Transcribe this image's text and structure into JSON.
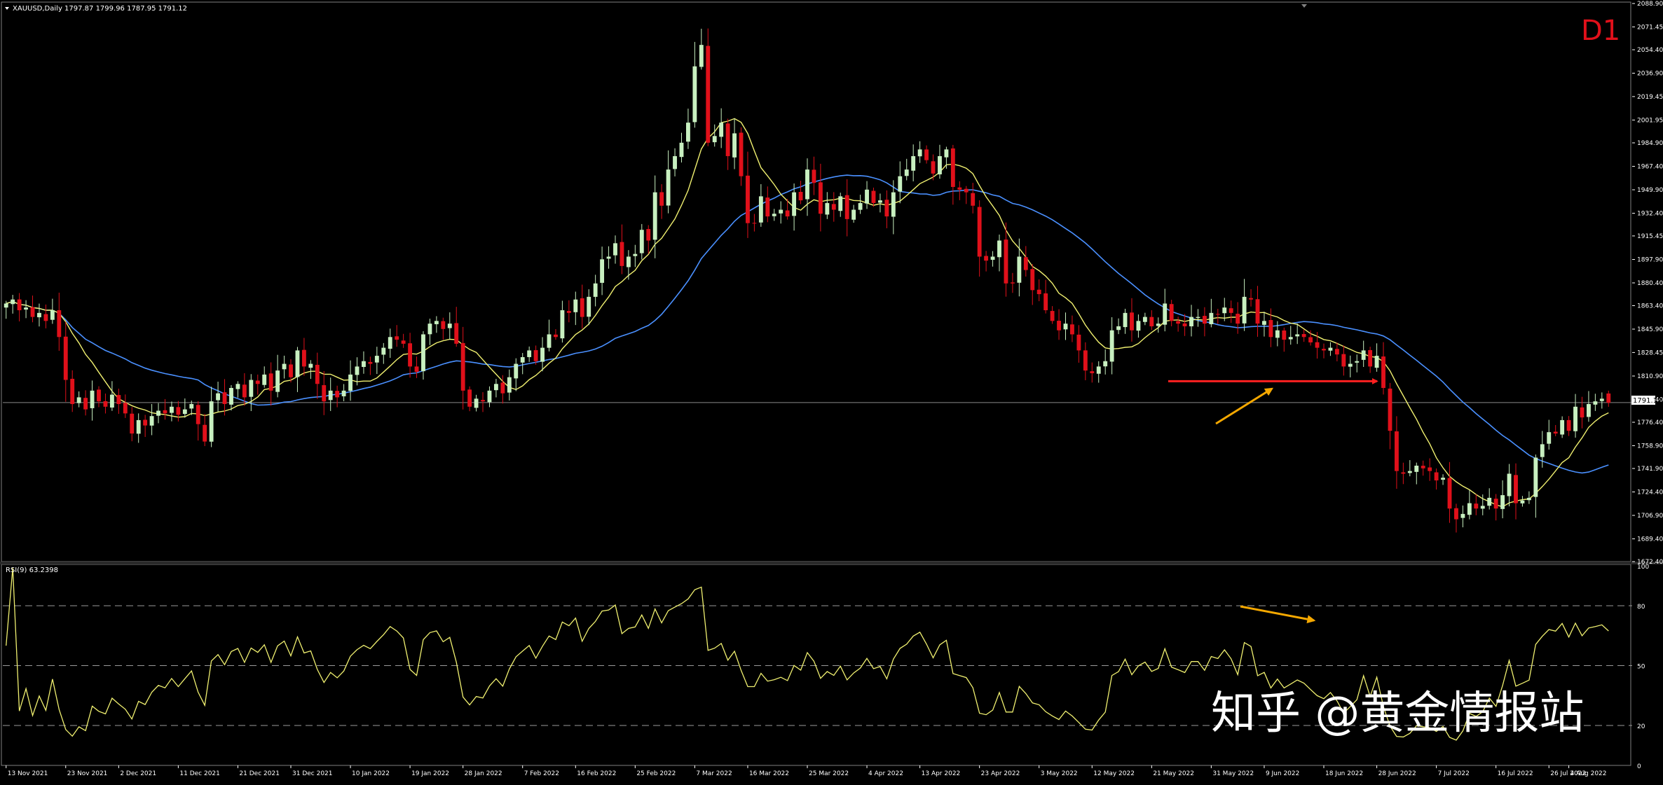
{
  "window": {
    "symbol_header": "XAUUSD,Daily  1797.87 1799.96 1787.95 1791.12",
    "timeframe_badge": "D1",
    "rsi_header": "RSI(9) 63.2398",
    "current_price_label": "1791.12",
    "watermark": "知乎 @黄金情报站"
  },
  "colors": {
    "background": "#000000",
    "bull_candle": "#c8f0c0",
    "bear_candle": "#e0101a",
    "ma_fast": "#f0f070",
    "ma_slow": "#4a90ff",
    "rsi_line": "#f0f070",
    "annotation_red": "#ff2020",
    "annotation_orange": "#f5a800",
    "axis_text": "#ffffff",
    "frame": "#808080",
    "badge": "#e0101a"
  },
  "chart_data": [
    {
      "type": "candlestick",
      "title": "XAUUSD,Daily",
      "ohlc_last": {
        "open": 1797.87,
        "high": 1799.96,
        "low": 1787.95,
        "close": 1791.12
      },
      "ylim": [
        1672.4,
        2088.9
      ],
      "ytick_labels": [
        "2088.90",
        "2071.45",
        "2054.40",
        "2036.90",
        "2019.45",
        "2001.95",
        "1984.90",
        "1967.40",
        "1949.90",
        "1932.40",
        "1915.45",
        "1897.90",
        "1880.40",
        "1863.40",
        "1845.90",
        "1828.45",
        "1810.90",
        "1793.40",
        "1776.40",
        "1758.90",
        "1741.90",
        "1724.40",
        "1706.90",
        "1689.40",
        "1672.40"
      ],
      "xtick_labels": [
        "13 Nov 2021",
        "23 Nov 2021",
        "2 Dec 2021",
        "11 Dec 2021",
        "21 Dec 2021",
        "31 Dec 2021",
        "10 Jan 2022",
        "19 Jan 2022",
        "28 Jan 2022",
        "7 Feb 2022",
        "16 Feb 2022",
        "25 Feb 2022",
        "7 Mar 2022",
        "16 Mar 2022",
        "25 Mar 2022",
        "4 Apr 2022",
        "13 Apr 2022",
        "23 Apr 2022",
        "3 May 2022",
        "12 May 2022",
        "21 May 2022",
        "31 May 2022",
        "9 Jun 2022",
        "18 Jun 2022",
        "28 Jun 2022",
        "7 Jul 2022",
        "16 Jul 2022",
        "26 Jul 2022",
        "4 Aug 2022"
      ],
      "close": [
        1865,
        1868,
        1860,
        1862,
        1855,
        1858,
        1852,
        1860,
        1840,
        1808,
        1790,
        1795,
        1786,
        1800,
        1792,
        1788,
        1797,
        1790,
        1783,
        1768,
        1778,
        1774,
        1781,
        1785,
        1783,
        1788,
        1782,
        1786,
        1790,
        1775,
        1762,
        1792,
        1798,
        1790,
        1802,
        1805,
        1795,
        1808,
        1805,
        1812,
        1800,
        1815,
        1820,
        1810,
        1830,
        1818,
        1820,
        1805,
        1792,
        1800,
        1795,
        1800,
        1812,
        1818,
        1822,
        1820,
        1826,
        1832,
        1840,
        1838,
        1835,
        1818,
        1814,
        1842,
        1850,
        1852,
        1846,
        1850,
        1835,
        1800,
        1788,
        1794,
        1792,
        1800,
        1805,
        1798,
        1810,
        1820,
        1825,
        1830,
        1822,
        1832,
        1842,
        1840,
        1860,
        1858,
        1868,
        1855,
        1870,
        1880,
        1898,
        1900,
        1910,
        1893,
        1900,
        1902,
        1920,
        1912,
        1948,
        1938,
        1965,
        1975,
        1985,
        2000,
        2042,
        2058,
        1985,
        1990,
        2000,
        1975,
        1992,
        1960,
        1925,
        1925,
        1945,
        1930,
        1932,
        1935,
        1930,
        1948,
        1942,
        1965,
        1955,
        1932,
        1940,
        1935,
        1945,
        1928,
        1935,
        1940,
        1950,
        1940,
        1942,
        1930,
        1948,
        1960,
        1965,
        1975,
        1980,
        1972,
        1962,
        1975,
        1980,
        1952,
        1950,
        1948,
        1938,
        1900,
        1897,
        1900,
        1912,
        1880,
        1880,
        1900,
        1890,
        1875,
        1872,
        1860,
        1852,
        1845,
        1850,
        1842,
        1830,
        1815,
        1813,
        1818,
        1822,
        1845,
        1848,
        1858,
        1845,
        1852,
        1855,
        1848,
        1850,
        1865,
        1852,
        1850,
        1848,
        1855,
        1855,
        1850,
        1858,
        1857,
        1862,
        1858,
        1850,
        1870,
        1868,
        1850,
        1852,
        1840,
        1845,
        1838,
        1840,
        1842,
        1840,
        1836,
        1832,
        1830,
        1832,
        1827,
        1818,
        1820,
        1822,
        1830,
        1818,
        1826,
        1802,
        1770,
        1740,
        1738,
        1740,
        1744,
        1742,
        1740,
        1733,
        1735,
        1712,
        1704,
        1708,
        1716,
        1712,
        1714,
        1720,
        1712,
        1722,
        1738,
        1716,
        1718,
        1720,
        1750,
        1760,
        1769,
        1768,
        1778,
        1770,
        1788,
        1780,
        1790,
        1792,
        1794,
        1791
      ]
    },
    {
      "type": "line",
      "title": "RSI(9) 63.2398",
      "ylim": [
        0,
        100
      ],
      "ytick_labels": [
        "100",
        "80",
        "50",
        "20",
        "0"
      ],
      "levels": [
        80,
        50,
        20
      ]
    }
  ]
}
